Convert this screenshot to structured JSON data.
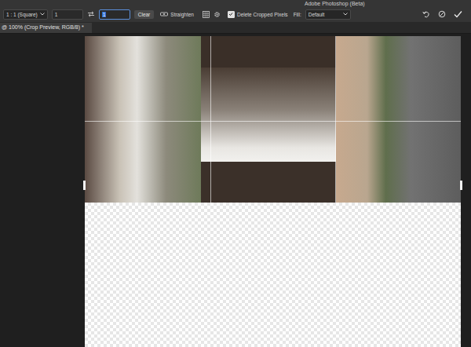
{
  "window": {
    "title": "Adobe Photoshop (Beta)"
  },
  "document_tab": {
    "label": "@ 100% (Crop Preview, RGB/8) *",
    "selected": true
  },
  "options_bar": {
    "ratio": {
      "value": "1 : 1 (Square)"
    },
    "width": {
      "value": "1",
      "selected": false
    },
    "height": {
      "value": "1",
      "selected": true
    },
    "clear_button": "Clear",
    "straighten_button": "Straighten",
    "delete_cropped": {
      "label": "Delete Cropped Pixels",
      "checked": true
    },
    "fill": {
      "label": "Fill:",
      "value": "Default"
    }
  },
  "canvas": {
    "photo": "aerial view of a dam",
    "grid": "rule of thirds"
  }
}
